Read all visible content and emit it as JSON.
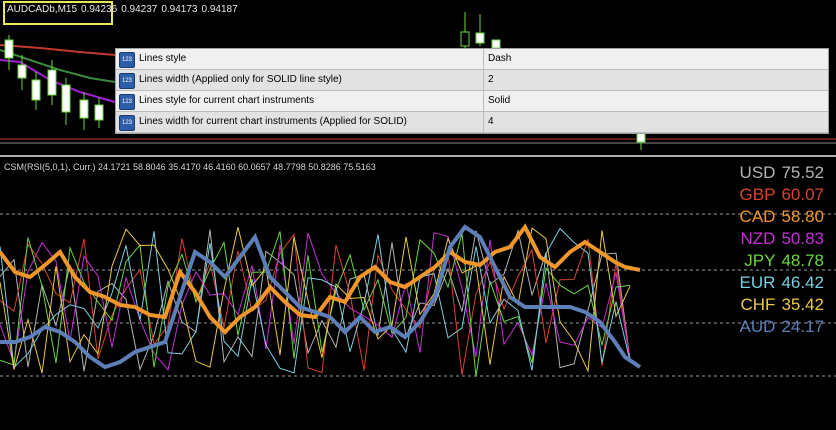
{
  "main_chart": {
    "symbol": "AUDCADb,M15",
    "ohlc": [
      "0.94236",
      "0.94237",
      "0.94173",
      "0.94187"
    ]
  },
  "properties": [
    {
      "icon": "number-param-icon",
      "name": "Lines style",
      "value": "Dash"
    },
    {
      "icon": "number-param-icon",
      "name": "Lines width (Applied only for SOLID line style)",
      "value": "2"
    },
    {
      "icon": "number-param-icon",
      "name": "Lines style for current chart instruments",
      "value": "Solid"
    },
    {
      "icon": "number-param-icon",
      "name": "Lines width for current chart instruments (Applied for SOLID)",
      "value": "4"
    }
  ],
  "indicator": {
    "label": "CSM(RSI(5,0,1), Curr.) 24.1721 58.8046 35.4170 46.4160 60.0657 48.7798 50.8286 75.5163"
  },
  "currencies": [
    {
      "name": "USD",
      "value": "75.52",
      "color": "#b4b4b4"
    },
    {
      "name": "GBP",
      "value": "60.07",
      "color": "#d8432c"
    },
    {
      "name": "CAD",
      "value": "58.80",
      "color": "#f0962a"
    },
    {
      "name": "NZD",
      "value": "50.83",
      "color": "#c62ed6"
    },
    {
      "name": "JPY",
      "value": "48.78",
      "color": "#6ad640"
    },
    {
      "name": "EUR",
      "value": "46.42",
      "color": "#7ad0e0"
    },
    {
      "name": "CHF",
      "value": "35.42",
      "color": "#ecc843"
    },
    {
      "name": "AUD",
      "value": "24.17",
      "color": "#5d7fb8"
    }
  ]
}
